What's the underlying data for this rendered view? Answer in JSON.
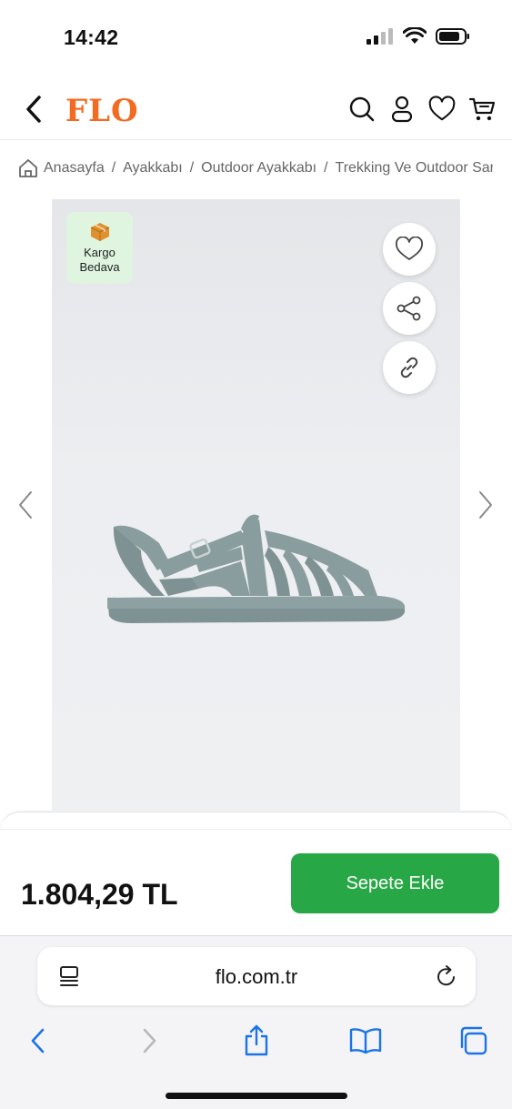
{
  "status": {
    "time": "14:42"
  },
  "header": {
    "logo": "FLO"
  },
  "breadcrumb": [
    "Anasayfa",
    "Ayakkabı",
    "Outdoor Ayakkabı",
    "Trekking Ve Outdoor Sandalet"
  ],
  "badge": {
    "line1": "Kargo",
    "line2": "Bedava"
  },
  "product": {
    "price": "1.804,29 TL",
    "add_to_cart": "Sepete Ekle"
  },
  "browser": {
    "url": "flo.com.tr"
  },
  "colors": {
    "brand": "#f26b21",
    "cta": "#27a745",
    "safari_blue": "#1a73e8"
  }
}
